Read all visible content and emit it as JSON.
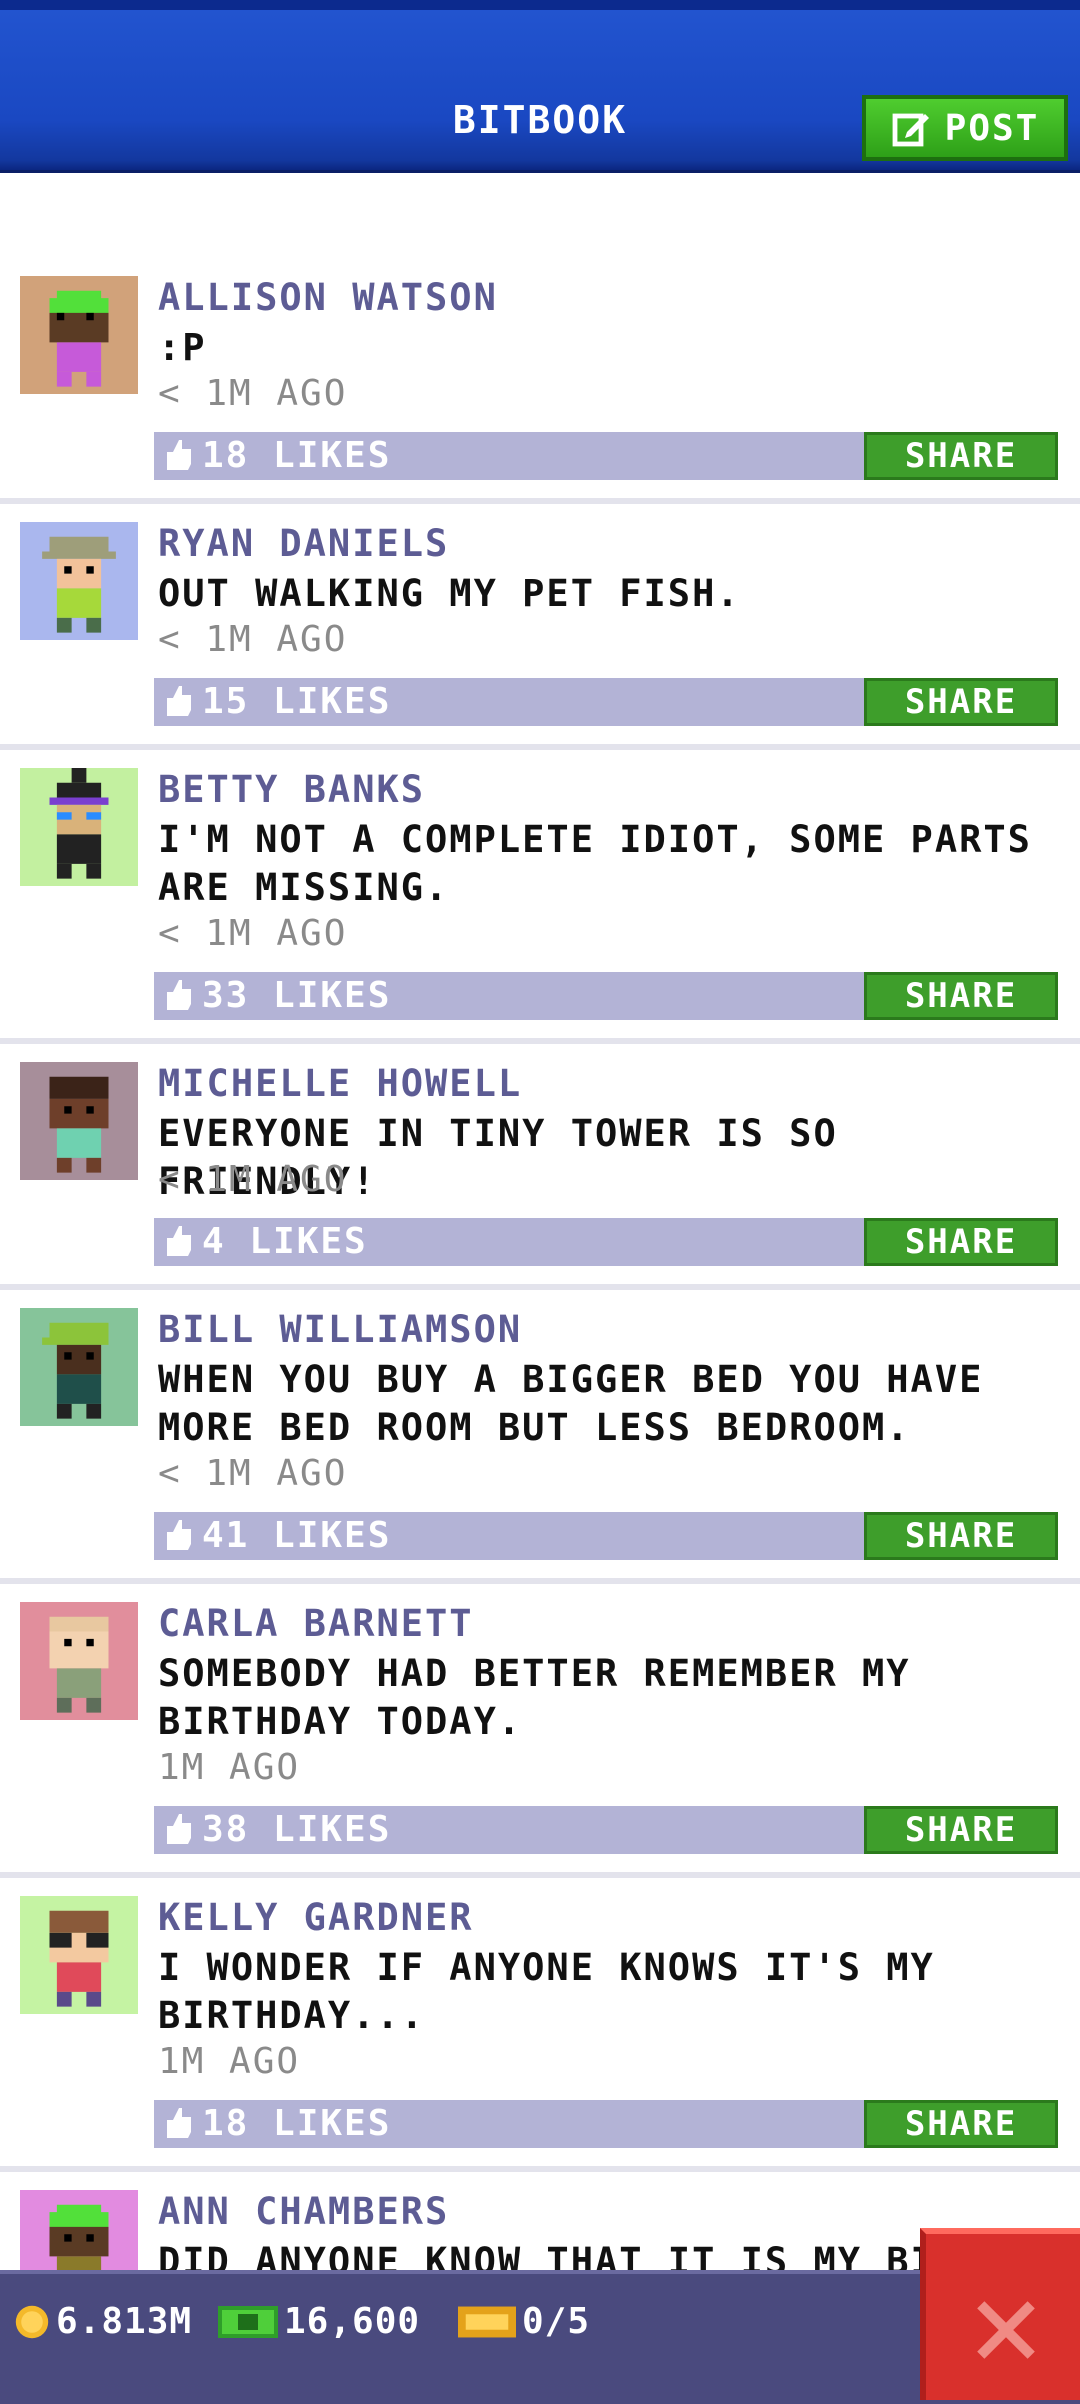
{
  "header": {
    "title": "BITBOOK",
    "post_label": "POST"
  },
  "posts": [
    {
      "name": "ALLISON WATSON",
      "message": ":P",
      "time": "< 1M AGO",
      "likes": "18 LIKES",
      "share": "SHARE",
      "avatar_bg": "#d1a27a"
    },
    {
      "name": "RYAN DANIELS",
      "message": "OUT WALKING MY PET FISH.",
      "time": "< 1M AGO",
      "likes": "15 LIKES",
      "share": "SHARE",
      "avatar_bg": "#aab7ee"
    },
    {
      "name": "BETTY BANKS",
      "message": "I'M NOT A COMPLETE IDIOT, SOME PARTS ARE MISSING.",
      "time": "< 1M AGO",
      "likes": "33 LIKES",
      "share": "SHARE",
      "avatar_bg": "#c3f0a0"
    },
    {
      "name": "MICHELLE HOWELL",
      "message": "EVERYONE IN TINY TOWER IS SO FRIENDLY!",
      "time": "< 1M AGO",
      "likes": "4 LIKES",
      "share": "SHARE",
      "avatar_bg": "#a78e9a"
    },
    {
      "name": "BILL WILLIAMSON",
      "message": "WHEN YOU BUY A BIGGER BED YOU HAVE MORE BED ROOM BUT LESS BEDROOM.",
      "time": "< 1M AGO",
      "likes": "41 LIKES",
      "share": "SHARE",
      "avatar_bg": "#86c49a"
    },
    {
      "name": "CARLA BARNETT",
      "message": "SOMEBODY HAD BETTER REMEMBER MY BIRTHDAY TODAY.",
      "time": "1M AGO",
      "likes": "38 LIKES",
      "share": "SHARE",
      "avatar_bg": "#e18e9c"
    },
    {
      "name": "KELLY GARDNER",
      "message": "I WONDER IF ANYONE KNOWS IT'S MY BIRTHDAY...",
      "time": "1M AGO",
      "likes": "18 LIKES",
      "share": "SHARE",
      "avatar_bg": "#c5f3a3"
    },
    {
      "name": "ANN CHAMBERS",
      "message": "DID ANYONE KNOW THAT IT IS MY BIRT",
      "time": "",
      "likes": "",
      "share": "",
      "avatar_bg": "#e28be0"
    }
  ],
  "status_bar": {
    "coins": "6.813M",
    "bux": "16,600",
    "tickets": "0/5"
  }
}
